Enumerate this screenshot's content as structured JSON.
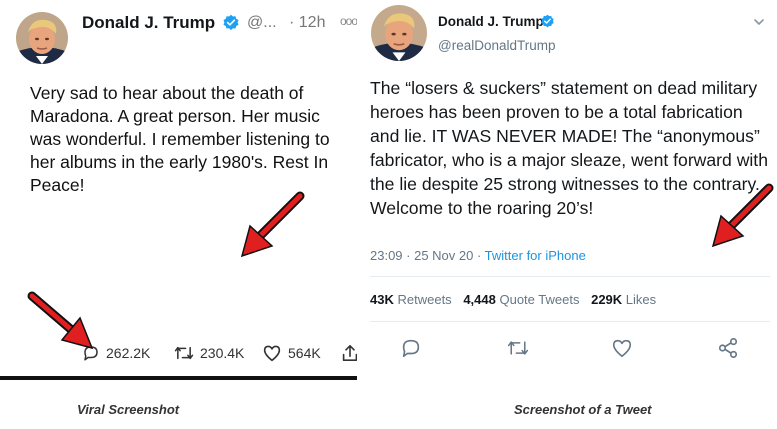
{
  "left_tweet": {
    "name": "Donald J. Trump",
    "handle": "@...",
    "time": "· 12h",
    "text": "Very sad to hear about the death of Maradona. A great person. Her music was wonderful. I remember listening to her albums in the early 1980's. Rest In Peace!",
    "replies": "262.2K",
    "retweets": "230.4K",
    "likes": "564K",
    "icons": [
      "verified-badge-icon",
      "more-icon",
      "reply-icon",
      "retweet-icon",
      "like-icon",
      "share-icon"
    ]
  },
  "right_tweet": {
    "name": "Donald J. Trump",
    "handle": "@realDonaldTrump",
    "text": "The “losers & suckers” statement on dead military heroes has been proven to be a total fabrication and lie. IT WAS NEVER MADE! The “anonymous” fabricator, who is a major sleaze, went forward with the lie despite 25 strong witnesses to the contrary. Welcome to the roaring 20’s!",
    "timestamp": "23:09 · 25 Nov 20 · ",
    "source": "Twitter for iPhone",
    "retweets_count": "43K",
    "retweets_label": "Retweets",
    "quote_count": "4,448",
    "quote_label": "Quote Tweets",
    "likes_count": "229K",
    "likes_label": "Likes",
    "icons": [
      "verified-badge-icon",
      "chevron-down-icon",
      "reply-icon",
      "retweet-icon",
      "like-icon",
      "share-icon"
    ]
  },
  "captions": {
    "left": "Viral Screenshot",
    "right": "Screenshot of a Tweet"
  },
  "colors": {
    "verified": "#1da1f2",
    "link": "#1b95e0",
    "arrow": "#e02020",
    "muted": "#657786"
  }
}
